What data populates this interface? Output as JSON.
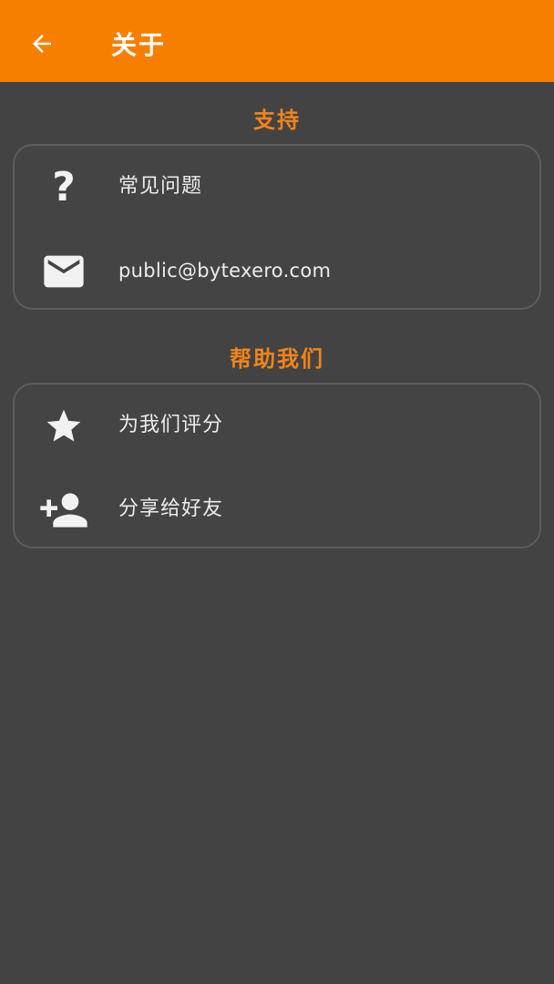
{
  "appbar": {
    "title": "关于",
    "background": "#f77f00",
    "back_icon": "arrow-left-icon"
  },
  "sections": [
    {
      "header": "支持",
      "items": [
        {
          "label": "常见问题",
          "icon": "question-mark-icon"
        },
        {
          "label": "public@bytexero.com",
          "icon": "email-icon"
        }
      ]
    },
    {
      "header": "帮助我们",
      "items": [
        {
          "label": "为我们评分",
          "icon": "star-icon"
        },
        {
          "label": "分享给好友",
          "icon": "person-add-icon"
        }
      ]
    }
  ],
  "colors": {
    "accent": "#f77f00",
    "section_header": "#f2841a",
    "background": "#434343",
    "card_border": "#5d5d5d",
    "text": "#ececec"
  }
}
